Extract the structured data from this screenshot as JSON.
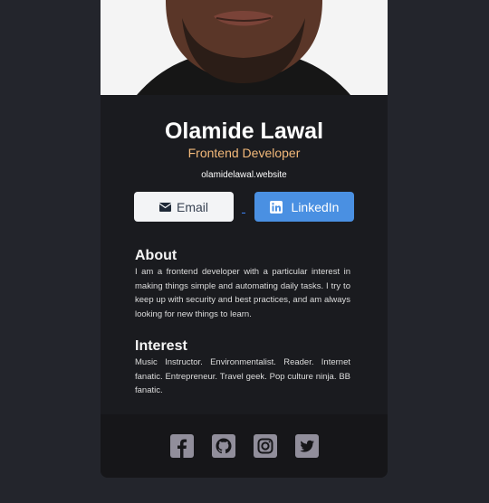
{
  "profile": {
    "name": "Olamide Lawal",
    "role": "Frontend Developer",
    "website": "olamidelawal.website"
  },
  "buttons": {
    "email_label": "Email",
    "linkedin_label": "LinkedIn"
  },
  "about": {
    "heading": "About",
    "text": "I am a frontend developer with a particular interest in making things simple and automating daily tasks. I try to keep up with security and best practices, and am always looking for new things to learn."
  },
  "interest": {
    "heading": "Interest",
    "text": "Music Instructor. Environmentalist. Reader. Internet fanatic. Entrepreneur. Travel geek. Pop culture ninja. BB fanatic."
  },
  "footer": {
    "icons": [
      "facebook-icon",
      "github-icon",
      "instagram-icon",
      "twitter-icon"
    ]
  },
  "colors": {
    "page_bg": "#23252c",
    "card_bg": "#1a1b1f",
    "footer_bg": "#161619",
    "accent_role": "#f3b97a",
    "linkedin_blue": "#4a90e2",
    "social_icon": "#918e9b"
  }
}
